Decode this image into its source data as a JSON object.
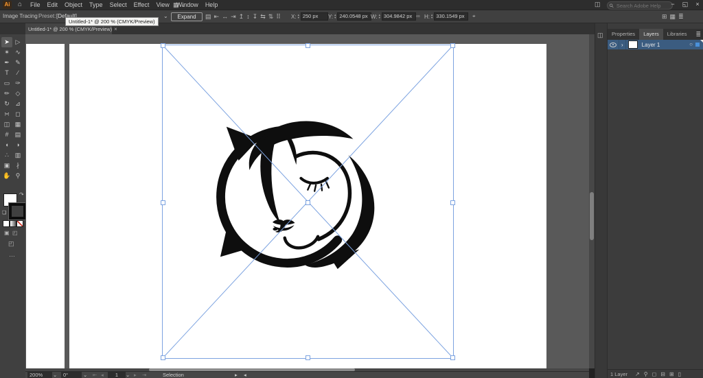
{
  "menubar": {
    "items": [
      "File",
      "Edit",
      "Object",
      "Type",
      "Select",
      "Effect",
      "View",
      "Window",
      "Help"
    ],
    "search_placeholder": "Search Adobe Help"
  },
  "icons": {
    "ai_logo": "Ai",
    "home": "⌂",
    "workspace_switcher": "▦",
    "chevron_down": "⌄",
    "window_arrange": "◫",
    "search": "⚲",
    "minimize": "−",
    "restore_down": "◱",
    "close": "×",
    "stepper_up": "▴",
    "stepper_down": "▾",
    "link_wh": "∞",
    "transform_more": "⌖",
    "swap_fill_stroke": "↷",
    "default_fill_stroke": "❏",
    "screen_mode": "◰",
    "toolbar_more": "…",
    "panel_menu": "≣",
    "dock_panel": "◫",
    "disclosure": "›",
    "target_circle": "○",
    "nav_first": "⇤",
    "nav_prev": "◂",
    "nav_next": "▸",
    "nav_last": "⇥",
    "status_fwd": "▸",
    "status_back": "◂",
    "tab_close": "×",
    "draw_normal": "▣",
    "draw_behind": "◰"
  },
  "controlbar": {
    "panel_label": "Image Tracing",
    "preset_label": "Preset:",
    "preset_value": "[Default]",
    "expand_label": "Expand",
    "fields": {
      "x": {
        "label": "X:",
        "value": "250 px"
      },
      "y": {
        "label": "Y:",
        "value": "240.0548 px"
      },
      "w": {
        "label": "W:",
        "value": "304.9842 px"
      },
      "h": {
        "label": "H:",
        "value": "330.1549 px"
      }
    },
    "left_icons": [
      {
        "name": "embed-options",
        "glyph": "▤"
      },
      {
        "name": "align-horizontal-left",
        "glyph": "⇤"
      },
      {
        "name": "align-horizontal-center",
        "glyph": "↔"
      },
      {
        "name": "align-horizontal-right",
        "glyph": "⇥"
      },
      {
        "name": "align-vertical-top",
        "glyph": "↥"
      },
      {
        "name": "align-vertical-center",
        "glyph": "↕"
      },
      {
        "name": "align-vertical-bottom",
        "glyph": "↧"
      },
      {
        "name": "distribute-horizontal",
        "glyph": "⇆"
      },
      {
        "name": "distribute-vertical",
        "glyph": "⇅"
      },
      {
        "name": "reference-point",
        "glyph": "⠿"
      }
    ],
    "right_icons": [
      {
        "name": "arrange-documents",
        "glyph": "⊞"
      },
      {
        "name": "workspace",
        "glyph": "▦"
      },
      {
        "name": "panel-list",
        "glyph": "≣"
      }
    ]
  },
  "tooltip": {
    "text": "Untitled-1* @ 200 % (CMYK/Preview)"
  },
  "document_tab": {
    "title": "Untitled-1* @ 200 % (CMYK/Preview)"
  },
  "toolbar": {
    "tools": [
      {
        "name": "selection-tool",
        "glyph": "➤",
        "active": true
      },
      {
        "name": "direct-selection-tool",
        "glyph": "▷"
      },
      {
        "name": "magic-wand-tool",
        "glyph": "✶"
      },
      {
        "name": "lasso-tool",
        "glyph": "∿"
      },
      {
        "name": "pen-tool",
        "glyph": "✒"
      },
      {
        "name": "curvature-tool",
        "glyph": "✎"
      },
      {
        "name": "type-tool",
        "glyph": "T"
      },
      {
        "name": "line-segment-tool",
        "glyph": "∕"
      },
      {
        "name": "rectangle-tool",
        "glyph": "▭"
      },
      {
        "name": "paintbrush-tool",
        "glyph": "✑"
      },
      {
        "name": "pencil-tool",
        "glyph": "✏"
      },
      {
        "name": "shaper-tool",
        "glyph": "◇"
      },
      {
        "name": "rotate-tool",
        "glyph": "↻"
      },
      {
        "name": "scale-tool",
        "glyph": "⊿"
      },
      {
        "name": "width-tool",
        "glyph": "∺"
      },
      {
        "name": "free-transform-tool",
        "glyph": "◻"
      },
      {
        "name": "shape-builder-tool",
        "glyph": "◫"
      },
      {
        "name": "perspective-grid-tool",
        "glyph": "▦"
      },
      {
        "name": "mesh-tool",
        "glyph": "#"
      },
      {
        "name": "gradient-tool",
        "glyph": "▤"
      },
      {
        "name": "eyedropper-tool",
        "glyph": "◖"
      },
      {
        "name": "blend-tool",
        "glyph": "◑"
      },
      {
        "name": "symbol-sprayer-tool",
        "glyph": "∴"
      },
      {
        "name": "column-graph-tool",
        "glyph": "▥"
      },
      {
        "name": "artboard-tool",
        "glyph": "▣"
      },
      {
        "name": "slice-tool",
        "glyph": "∤"
      },
      {
        "name": "hand-tool",
        "glyph": "✋"
      },
      {
        "name": "zoom-tool",
        "glyph": "⚲"
      }
    ]
  },
  "layers_panel": {
    "tabs": [
      "Properties",
      "Layers",
      "Libraries"
    ],
    "active_tab": "Layers",
    "rows": [
      {
        "name": "Layer 1"
      }
    ],
    "footer": {
      "count_label": "1 Layer",
      "icons": [
        {
          "name": "collect-for-export",
          "glyph": "↗"
        },
        {
          "name": "locate-object",
          "glyph": "⚲"
        },
        {
          "name": "make-clipping-mask",
          "glyph": "◻"
        },
        {
          "name": "new-sublayer",
          "glyph": "⊟"
        },
        {
          "name": "new-layer",
          "glyph": "⊞"
        },
        {
          "name": "delete-selection",
          "glyph": "▯"
        }
      ]
    }
  },
  "statusbar": {
    "zoom": "200%",
    "rotation": "0°",
    "artboard_number": "1",
    "tool_label": "Selection"
  },
  "artwork": {
    "name": "crescent-moon-face-logo"
  },
  "colors": {
    "selection_blue": "#7ba2e0",
    "layer_selected_bg": "#3b5c80",
    "accent_blue": "#4a90d9",
    "artwork_black": "#0e0e0e",
    "pasteboard_gray": "#595959"
  }
}
